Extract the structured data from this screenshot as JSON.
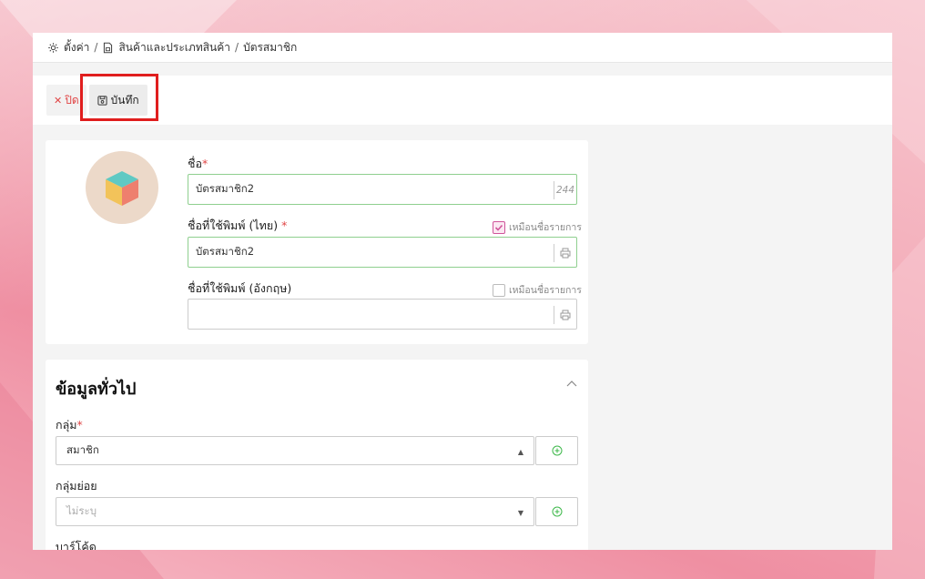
{
  "breadcrumb": {
    "items": [
      "ตั้งค่า",
      "สินค้าและประเภทสินค้า",
      "บัตรสมาชิก"
    ],
    "separator": "/"
  },
  "toolbar": {
    "close_label": "ปิด",
    "save_label": "บันทึก"
  },
  "form": {
    "name_label": "ชื่อ",
    "name_value": "บัตรสมาชิก2",
    "name_remaining": "244",
    "print_th_label": "ชื่อที่ใช้พิมพ์ (ไทย)",
    "print_th_value": "บัตรสมาชิก2",
    "print_th_same_label": "เหมือนชื่อรายการ",
    "print_th_same_checked": true,
    "print_en_label": "ชื่อที่ใช้พิมพ์ (อังกฤษ)",
    "print_en_value": "",
    "print_en_same_label": "เหมือนชื่อรายการ",
    "print_en_same_checked": false,
    "required_mark": "*"
  },
  "general": {
    "title": "ข้อมูลทั่วไป",
    "group_label": "กลุ่ม",
    "group_value": "สมาชิก",
    "subgroup_label": "กลุ่มย่อย",
    "subgroup_placeholder": "ไม่ระบุ",
    "barcode_label": "บาร์โค้ด"
  },
  "colors": {
    "accent_error": "#e04545",
    "valid_border": "#8fcf8f",
    "add_icon": "#3db84a",
    "checkbox_accent": "#d0559a",
    "highlight": "#e01e1e"
  }
}
